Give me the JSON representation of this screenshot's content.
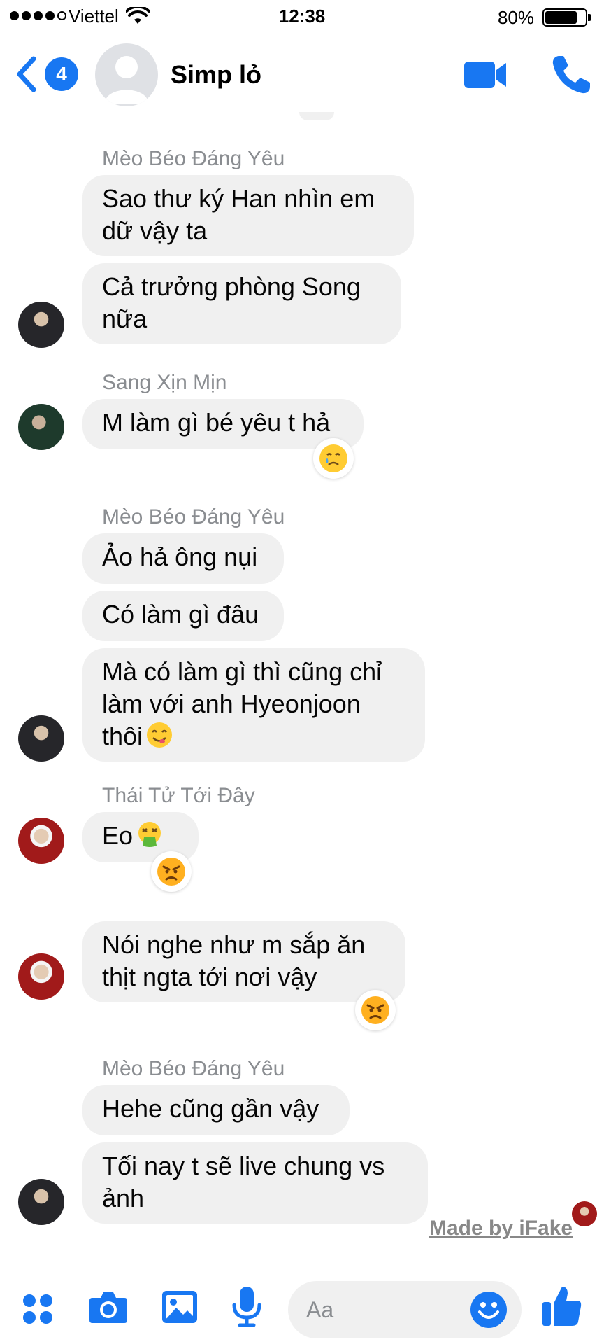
{
  "status_bar": {
    "carrier": "Viettel",
    "time": "12:38",
    "battery": "80%"
  },
  "header": {
    "unread_count": "4",
    "title": "Simp lỏ"
  },
  "messages": [
    {
      "sender": "Mèo Béo Đáng Yêu",
      "lines": [
        "Sao thư ký Han nhìn em",
        "dữ vậy ta"
      ]
    },
    {
      "lines": [
        "Cả trưởng phòng Song",
        "nữa"
      ]
    },
    {
      "sender": "Sang Xịn Mịn",
      "lines": [
        "M làm gì bé yêu t hả"
      ],
      "reaction": "cry-emoji"
    },
    {
      "sender": "Mèo Béo Đáng Yêu",
      "lines": [
        "Ảo hả ông nụi"
      ]
    },
    {
      "lines": [
        "Có làm gì đâu"
      ]
    },
    {
      "lines": [
        "Mà có làm gì thì cũng chỉ",
        "làm với anh Hyeonjoon",
        "thôi"
      ],
      "inline_emoji": "yum-emoji"
    },
    {
      "sender": "Thái Tử Tới Đây",
      "lines": [
        "Eo"
      ],
      "inline_emoji": "vomit-emoji",
      "reaction": "angry-emoji"
    },
    {
      "lines": [
        "Nói nghe như m sắp ăn",
        "thịt ngta tới nơi vậy"
      ],
      "reaction": "angry-emoji"
    },
    {
      "sender": "Mèo Béo Đáng Yêu",
      "lines": [
        "Hehe cũng gần vậy"
      ]
    },
    {
      "lines": [
        "Tối nay t sẽ live chung vs",
        "ảnh"
      ]
    }
  ],
  "watermark": "Made by iFake",
  "composer": {
    "placeholder": "Aa"
  },
  "colors": {
    "accent": "#1877f2",
    "bubble": "#f0f0f0",
    "sender_name": "#8a8d91"
  },
  "icons": [
    "back-chevron-icon",
    "video-call-icon",
    "phone-icon",
    "apps-icon",
    "camera-icon",
    "photo-icon",
    "microphone-icon",
    "emoji-icon",
    "thumbs-up-icon"
  ]
}
